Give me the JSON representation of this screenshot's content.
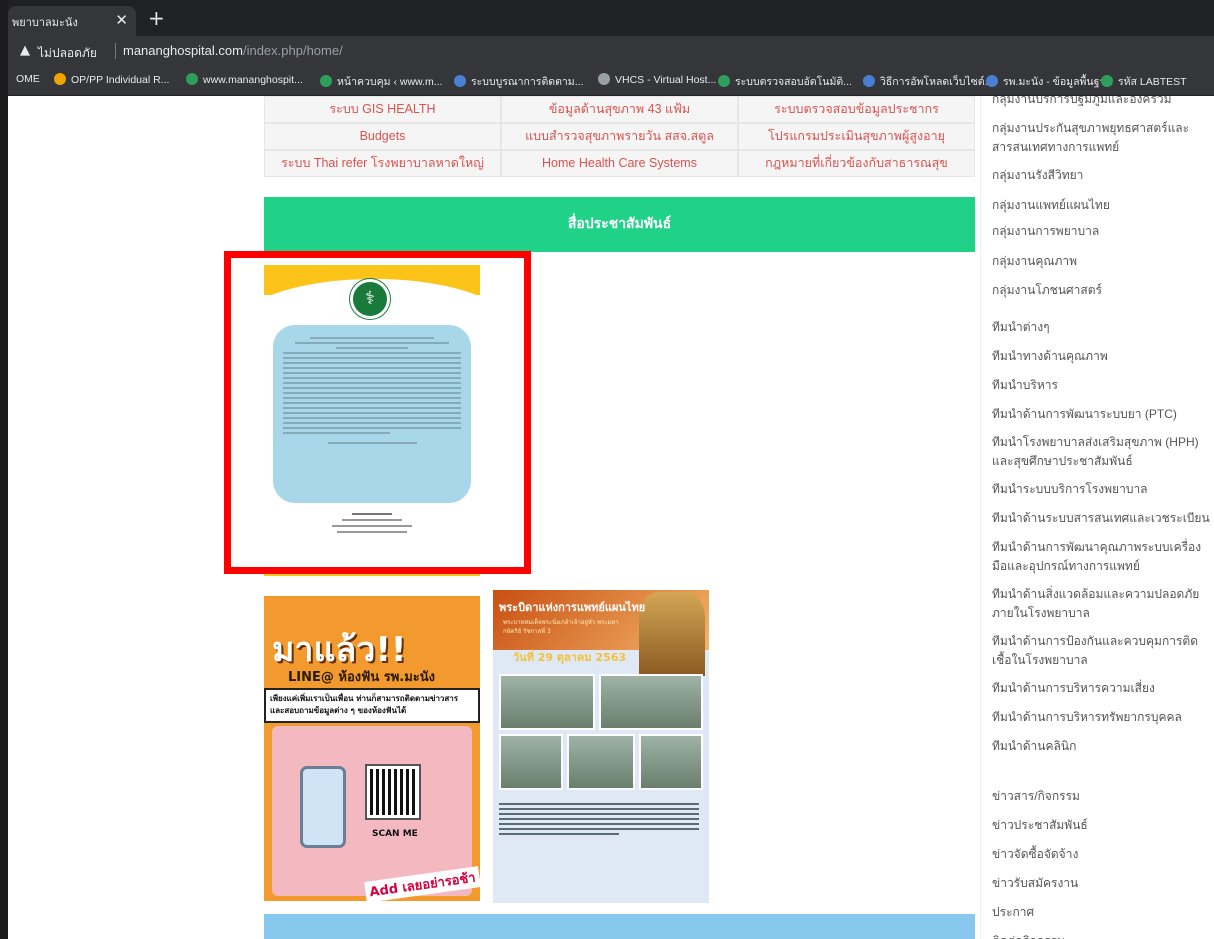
{
  "browser": {
    "tab_title": "พยาบาลมะนัง",
    "insecure_label": "ไม่ปลอดภัย",
    "url_host": "mananghospital.com",
    "url_path": "/index.php/home/",
    "bookmarks": [
      {
        "label": "OME",
        "color": "#35363a"
      },
      {
        "label": "OP/PP Individual R...",
        "color": "#f0a400"
      },
      {
        "label": "www.mananghospit...",
        "color": "#2e9e5b"
      },
      {
        "label": "หน้าควบคุม ‹ www.m...",
        "color": "#2e9e5b"
      },
      {
        "label": "ระบบบูรณาการติดตาม...",
        "color": "#4a7fd4"
      },
      {
        "label": "VHCS - Virtual Host...",
        "color": "#9aa0a6"
      },
      {
        "label": "ระบบตรวจสอบอัตโนมัติ...",
        "color": "#2e9e5b"
      },
      {
        "label": "วิธีการอัพโหลดเว็บไซต์...",
        "color": "#4a7fd4"
      },
      {
        "label": "รพ.มะนัง - ข้อมูลพื้นฐาน",
        "color": "#4a7fd4"
      },
      {
        "label": "รหัส LABTEST",
        "color": "#2e9e5b"
      }
    ]
  },
  "links": [
    [
      "ระบบ GIS HEALTH",
      "ข้อมูลด้านสุขภาพ 43 แฟ้ม",
      "ระบบตรวจสอบข้อมูลประชากร"
    ],
    [
      "Budgets",
      "แบบสำรวจสุขภาพรายวัน สสจ.สตูล",
      "โปรแกรมประเมินสุขภาพผู้สูงอายุ"
    ],
    [
      "ระบบ Thai refer โรงพยาบาลหาดใหญ่",
      "Home Health Care Systems",
      "กฎหมายที่เกี่ยวข้องกับสาธารณสุข"
    ]
  ],
  "pr_section_title": "สื่อประชาสัมพันธ์",
  "posters": {
    "line": {
      "title": "มาแล้ว!!",
      "subtitle": "LINE@ ห้องฟัน รพ.มะนัง",
      "desc": "เพียงแค่เพิ่มเราเป็นเพื่อน ท่านก็สามารถติดตามข่าวสาร และสอบถามข้อมูลต่าง ๆ ของห้องฟันได้",
      "scan": "SCAN ME",
      "cta": "Add เลยอย่ารอช้า"
    },
    "thai": {
      "title": "พระบิดาแห่งการแพทย์แผนไทย",
      "subtitle": "พระบาทสมเด็จพระนั่งเกล้าเจ้าอยู่หัว พระมหากษัตริย์ รัชกาลที่ 3",
      "date": "วันที่ 29 ตุลาคม 2563"
    }
  },
  "sidebar": [
    "กลุ่มงานบริการปฐมภูมิและองค์รวม",
    "กลุ่มงานประกันสุขภาพยุทธศาสตร์และสารสนเทศทางการแพทย์",
    "กลุ่มงานรังสีวิทยา",
    "กลุ่มงานแพทย์แผนไทย",
    "กลุ่มงานการพยาบาล",
    "กลุ่มงานคุณภาพ",
    "กลุ่มงานโภชนศาสตร์",
    "ทีมนำต่างๆ",
    "ทีมนำทางด้านคุณภาพ",
    "ทีมนำบริหาร",
    "ทีมนำด้านการพัฒนาระบบยา (PTC)",
    "ทีมนำโรงพยาบาลส่งเสริมสุขภาพ (HPH) และสุขศึกษาประชาสัมพันธ์",
    "ทีมนำระบบบริการโรงพยาบาล",
    "ทีมนำด้านระบบสารสนเทศและเวชระเบียน",
    "ทีมนำด้านการพัฒนาคุณภาพระบบเครื่องมือและอุปกรณ์ทางการแพทย์",
    "ทีมนำด้านสิ่งแวดล้อมและความปลอดภัยภายในโรงพยาบาล",
    "ทีมนำด้านการป้องกันและควบคุมการติดเชื้อในโรงพยาบาล",
    "ทีมนำด้านการบริหารความเสี่ยง",
    "ทีมนำด้านการบริหารทรัพยากรบุคคล",
    "ทีมนำด้านคลินิก",
    "ข่าวสาร/กิจกรรม",
    "ข่าวประชาสัมพันธ์",
    "ข่าวจัดซื้อจัดจ้าง",
    "ข่าวรับสมัครงาน",
    "ประกาศ",
    "ติดต่อกิจกรรม"
  ]
}
